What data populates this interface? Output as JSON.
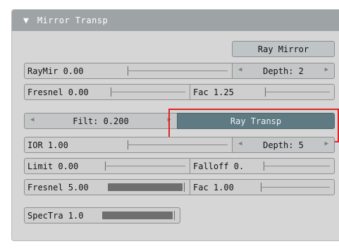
{
  "panel": {
    "title": "Mirror Transp",
    "collapse_icon": "triangle-down-icon"
  },
  "mirror": {
    "ray_mirror_button": "Ray Mirror",
    "raymir": {
      "label": "RayMir 0.00",
      "value": 0.0
    },
    "depth": "Depth: 2",
    "fresnel": {
      "label": "Fresnel 0.00",
      "value": 0.0
    },
    "fac": {
      "label": "Fac 1.25",
      "value": 0.25
    }
  },
  "transp": {
    "filt": "Filt: 0.200",
    "ray_transp_button": "Ray Transp",
    "ior": {
      "label": "IOR 1.00",
      "value": 0.0
    },
    "depth": "Depth: 5",
    "limit": {
      "label": "Limit 0.00",
      "value": 0.0
    },
    "falloff": {
      "label": "Falloff 0.",
      "value": 0.0
    },
    "fresnel": {
      "label": "Fresnel 5.00",
      "value": 1.0
    },
    "fac": {
      "label": "Fac 1.00",
      "value": 0.0
    }
  },
  "spectra": {
    "label": "SpecTra 1.0",
    "value": 1.0
  },
  "colors": {
    "panel_bg": "#d6d6d6",
    "header_bg": "#9ea3a6",
    "active_button": "#5f7a82",
    "highlight": "#e02222"
  }
}
